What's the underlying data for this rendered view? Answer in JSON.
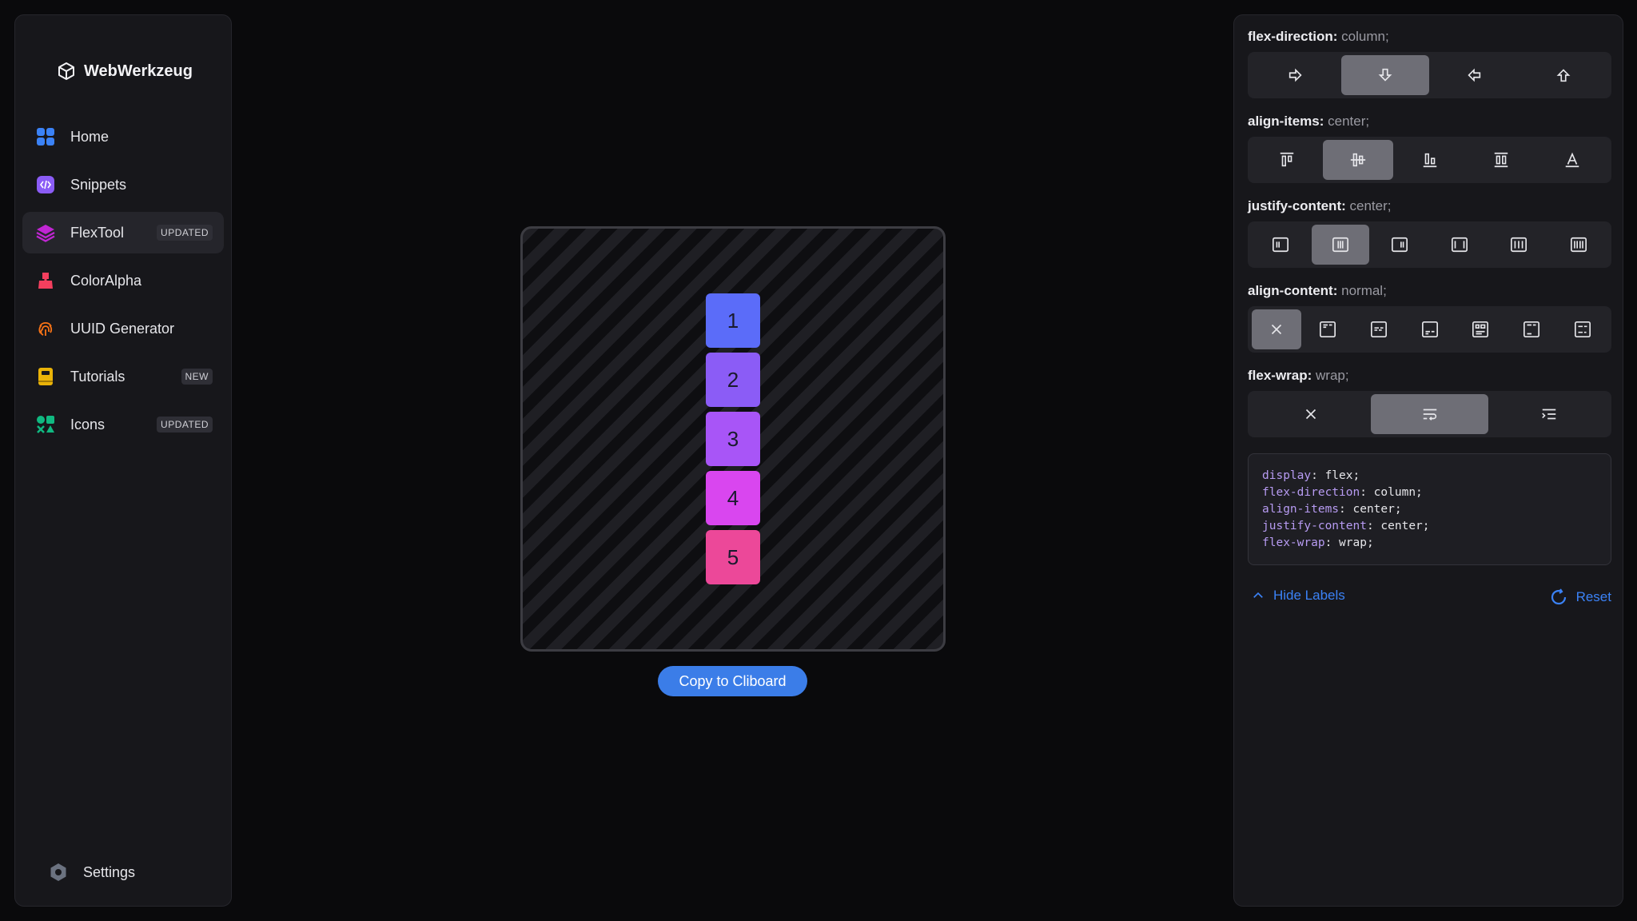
{
  "app": {
    "name": "WebWerkzeug"
  },
  "nav": [
    {
      "label": "Home",
      "badge": "",
      "icon": "grid-icon",
      "color": "#3b82f6"
    },
    {
      "label": "Snippets",
      "badge": "",
      "icon": "code-icon",
      "color": "#8b5cf6"
    },
    {
      "label": "FlexTool",
      "badge": "UPDATED",
      "icon": "layers-icon",
      "color": "#c026d3",
      "active": true
    },
    {
      "label": "ColorAlpha",
      "badge": "",
      "icon": "paint-icon",
      "color": "#f43f5e"
    },
    {
      "label": "UUID Generator",
      "badge": "",
      "icon": "fingerprint-icon",
      "color": "#f97316"
    },
    {
      "label": "Tutorials",
      "badge": "NEW",
      "icon": "book-icon",
      "color": "#eab308"
    },
    {
      "label": "Icons",
      "badge": "UPDATED",
      "icon": "shapes-icon",
      "color": "#10b981"
    }
  ],
  "settings": {
    "label": "Settings"
  },
  "preview": {
    "items": [
      {
        "label": "1",
        "color": "#5b6cf9"
      },
      {
        "label": "2",
        "color": "#8b5cf6"
      },
      {
        "label": "3",
        "color": "#a855f7"
      },
      {
        "label": "4",
        "color": "#d946ef"
      },
      {
        "label": "5",
        "color": "#ec4899"
      }
    ]
  },
  "copy_button": {
    "label": "Copy to Cliboard"
  },
  "props": {
    "flex_direction": {
      "name": "flex-direction:",
      "value": "column;"
    },
    "align_items": {
      "name": "align-items:",
      "value": "center;"
    },
    "justify_content": {
      "name": "justify-content:",
      "value": "center;"
    },
    "align_content": {
      "name": "align-content:",
      "value": "normal;"
    },
    "flex_wrap": {
      "name": "flex-wrap:",
      "value": "wrap;"
    }
  },
  "code": {
    "lines": [
      {
        "key": "display",
        "val": ": flex;"
      },
      {
        "key": "flex-direction",
        "val": ": column;"
      },
      {
        "key": "align-items",
        "val": ": center;"
      },
      {
        "key": "justify-content",
        "val": ": center;"
      },
      {
        "key": "flex-wrap",
        "val": ": wrap;"
      }
    ]
  },
  "links": {
    "hide_labels": "Hide Labels",
    "reset": "Reset"
  }
}
